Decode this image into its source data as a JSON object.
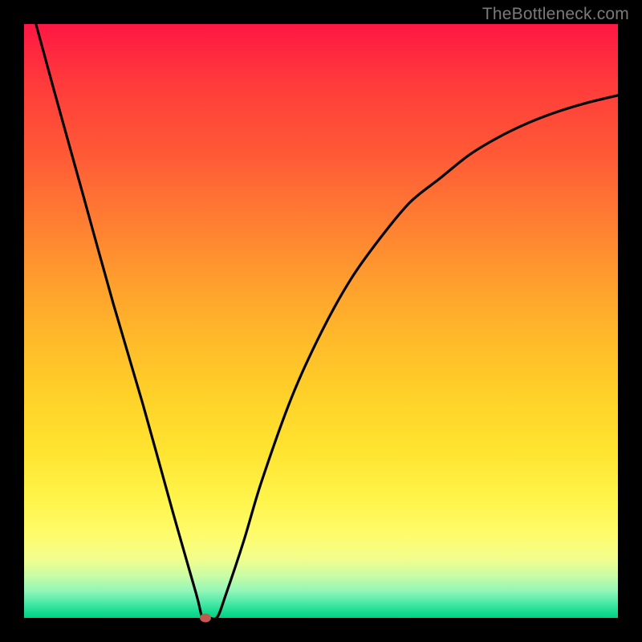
{
  "watermark": "TheBottleneck.com",
  "chart_data": {
    "type": "line",
    "title": "",
    "xlabel": "",
    "ylabel": "",
    "xlim": [
      0,
      1
    ],
    "ylim": [
      0,
      1
    ],
    "series": [
      {
        "name": "curve",
        "x": [
          0.02,
          0.05,
          0.1,
          0.15,
          0.2,
          0.25,
          0.29,
          0.3,
          0.31,
          0.325,
          0.34,
          0.37,
          0.4,
          0.45,
          0.5,
          0.55,
          0.6,
          0.65,
          0.7,
          0.75,
          0.8,
          0.85,
          0.9,
          0.95,
          1.0
        ],
        "y": [
          1.0,
          0.89,
          0.71,
          0.53,
          0.36,
          0.18,
          0.04,
          0.001,
          0.001,
          0.001,
          0.04,
          0.13,
          0.23,
          0.37,
          0.48,
          0.57,
          0.64,
          0.7,
          0.74,
          0.78,
          0.81,
          0.834,
          0.853,
          0.868,
          0.88
        ]
      }
    ],
    "marker": {
      "x": 0.305,
      "y": 0.0
    },
    "background_gradient": {
      "top": "#ff1744",
      "mid": "#ffe431",
      "bottom": "#00d084"
    }
  }
}
